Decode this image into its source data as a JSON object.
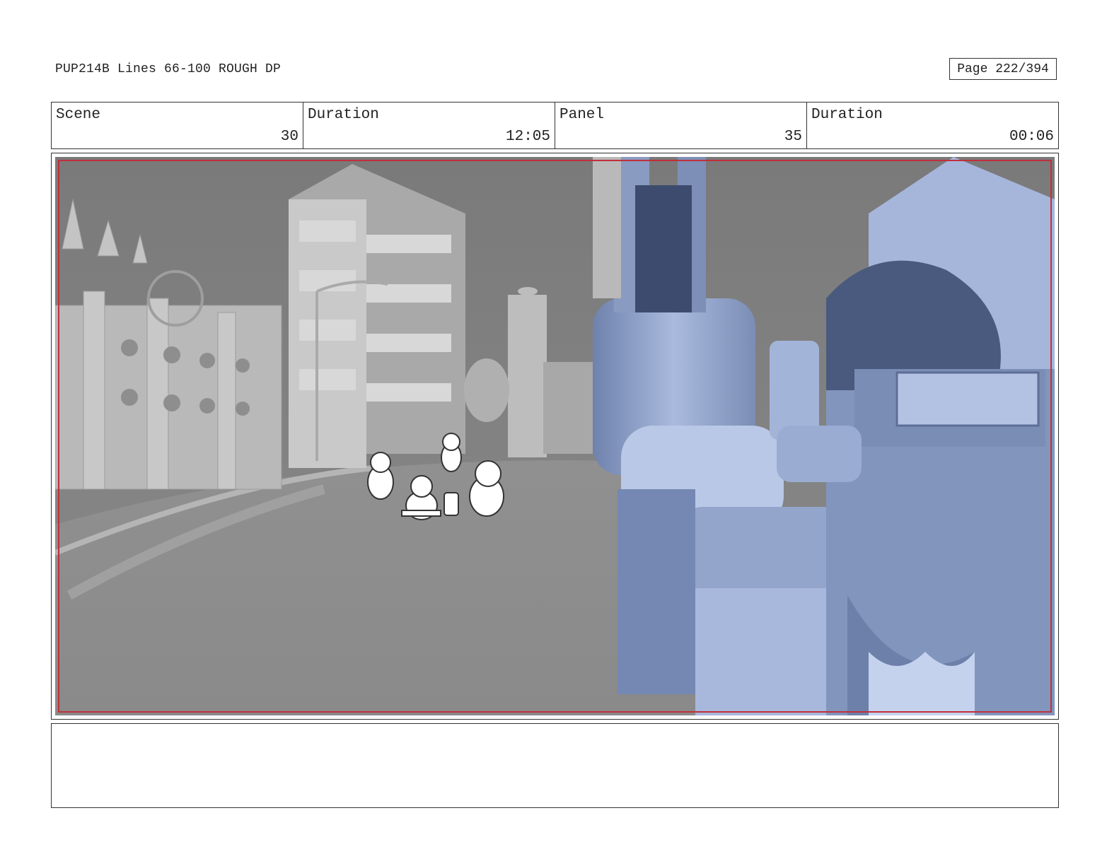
{
  "header": {
    "title": "PUP214B Lines 66-100 ROUGH DP",
    "page": "Page 222/394"
  },
  "info": [
    {
      "label": "Scene",
      "value": "30"
    },
    {
      "label": "Duration",
      "value": "12:05"
    },
    {
      "label": "Panel",
      "value": "35"
    },
    {
      "label": "Duration",
      "value": "00:06"
    }
  ],
  "panel": {
    "safe_frame_color": "#c0303a",
    "background_color": "#8e8e8e",
    "vehicle_color": "#8e9fc4"
  },
  "notes": {
    "text": ""
  }
}
